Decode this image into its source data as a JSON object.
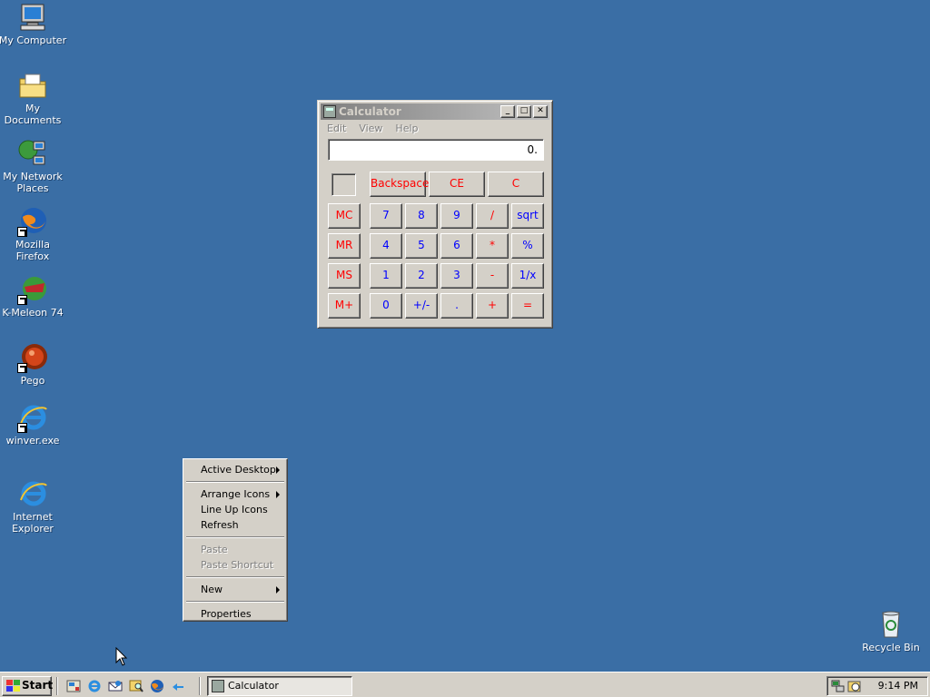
{
  "desktop": {
    "background_color": "#3a6ea5",
    "icons": [
      {
        "label": "My Computer",
        "icon": "computer-icon"
      },
      {
        "label": "My Documents",
        "icon": "folder-icon"
      },
      {
        "label": "My Network Places",
        "icon": "network-icon"
      },
      {
        "label": "Mozilla Firefox",
        "icon": "firefox-icon"
      },
      {
        "label": "K-Meleon 74",
        "icon": "kmeleon-icon"
      },
      {
        "label": "Pego",
        "icon": "pego-icon"
      },
      {
        "label": "winver.exe",
        "icon": "ie-icon"
      },
      {
        "label": "Internet Explorer",
        "icon": "ie-icon"
      },
      {
        "label": "Recycle Bin",
        "icon": "recycle-bin-icon"
      }
    ]
  },
  "calculator": {
    "title": "Calculator",
    "menu": [
      "Edit",
      "View",
      "Help"
    ],
    "display_value": "0.",
    "buttons": {
      "backspace": "Backspace",
      "ce": "CE",
      "c": "C",
      "mc": "MC",
      "mr": "MR",
      "ms": "MS",
      "mplus": "M+",
      "n7": "7",
      "n8": "8",
      "n9": "9",
      "n4": "4",
      "n5": "5",
      "n6": "6",
      "n1": "1",
      "n2": "2",
      "n3": "3",
      "n0": "0",
      "plusminus": "+/-",
      "dot": ".",
      "div": "/",
      "mul": "*",
      "sub": "-",
      "add": "+",
      "sqrt": "sqrt",
      "pct": "%",
      "recip": "1/x",
      "eq": "="
    },
    "title_buttons": {
      "minimize": "_",
      "maximize": "□",
      "close": "✕"
    }
  },
  "context_menu": {
    "items": {
      "active_desktop": "Active Desktop",
      "arrange_icons": "Arrange Icons",
      "line_up_icons": "Line Up Icons",
      "refresh": "Refresh",
      "paste": "Paste",
      "paste_shortcut": "Paste Shortcut",
      "new": "New",
      "properties": "Properties"
    }
  },
  "taskbar": {
    "start_label": "Start",
    "task_calculator": "Calculator",
    "clock": "9:14 PM"
  }
}
